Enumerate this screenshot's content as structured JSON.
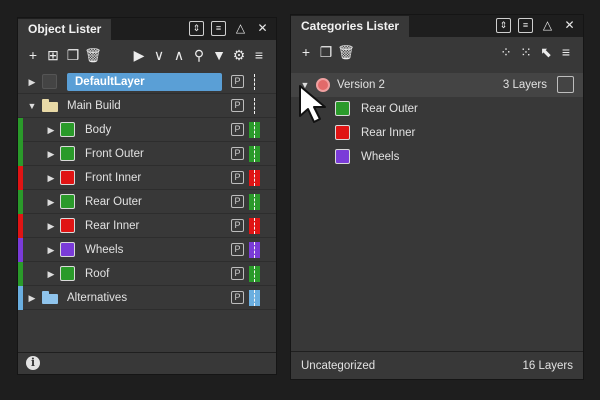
{
  "object_lister": {
    "title": "Object Lister",
    "rows": [
      {
        "label": "DefaultLayer",
        "selected": true,
        "p": "P",
        "color": "#4a4a4a",
        "strip": null
      },
      {
        "label": "Main Build",
        "folder": true,
        "p": "P",
        "color": "#383838",
        "strip": null
      },
      {
        "label": "Body",
        "p": "P",
        "color": "#2a9a2a",
        "strip": "#2a9a2a"
      },
      {
        "label": "Front Outer",
        "p": "P",
        "color": "#2a9a2a",
        "strip": "#2a9a2a"
      },
      {
        "label": "Front Inner",
        "p": "P",
        "color": "#e01414",
        "strip": "#e01414"
      },
      {
        "label": "Rear Outer",
        "p": "P",
        "color": "#2a9a2a",
        "strip": "#2a9a2a"
      },
      {
        "label": "Rear Inner",
        "p": "P",
        "color": "#e01414",
        "strip": "#e01414"
      },
      {
        "label": "Wheels",
        "p": "P",
        "color": "#7a3bd8",
        "strip": "#7a3bd8"
      },
      {
        "label": "Roof",
        "p": "P",
        "color": "#2a9a2a",
        "strip": "#2a9a2a"
      },
      {
        "label": "Alternatives",
        "folder": true,
        "p": "P",
        "color": "#6aaee0",
        "strip": "#6aaee0"
      }
    ]
  },
  "categories_lister": {
    "title": "Categories Lister",
    "version": {
      "label": "Version 2",
      "count": "3 Layers"
    },
    "items": [
      {
        "label": "Rear Outer",
        "color": "#2a9a2a"
      },
      {
        "label": "Rear Inner",
        "color": "#e01414"
      },
      {
        "label": "Wheels",
        "color": "#7a3bd8"
      }
    ],
    "footer_label": "Uncategorized",
    "footer_count": "16 Layers"
  },
  "icons": {
    "panel_title": [
      "pin-icon",
      "menu-icon",
      "collapse-icon",
      "close-icon"
    ],
    "obj_toolbar": [
      "add-icon",
      "add-folder-icon",
      "duplicate-icon",
      "delete-icon",
      "play-icon",
      "chevron-down-icon",
      "chevron-up-icon",
      "search-icon",
      "filter-icon",
      "gear-icon",
      "menu-icon"
    ],
    "cat_toolbar": [
      "add-icon",
      "duplicate-icon",
      "delete-icon",
      "grid-icon",
      "grid-alt-icon",
      "select-icon",
      "menu-icon"
    ]
  },
  "colors": {
    "selection": "#5a9fd6",
    "panel": "#383838",
    "background": "#1e1e1e"
  }
}
